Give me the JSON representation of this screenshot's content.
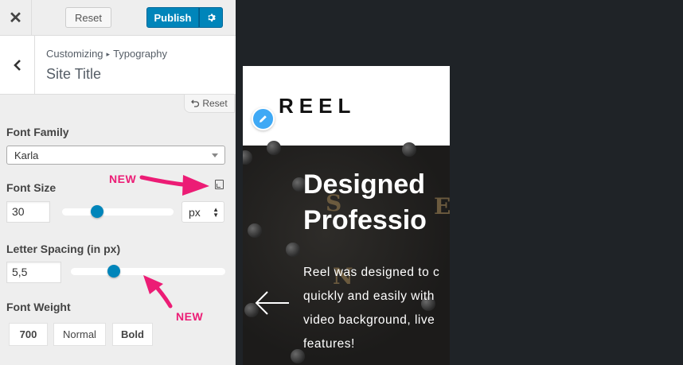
{
  "topbar": {
    "close_icon": "close-icon",
    "reset_label": "Reset",
    "publish_label": "Publish",
    "publish_settings_icon": "gear-icon",
    "publish_color": "#0085ba"
  },
  "section": {
    "breadcrumb_parent": "Customizing",
    "breadcrumb_separator": "▸",
    "breadcrumb_current": "Typography",
    "title": "Site Title",
    "reset_label": "Reset"
  },
  "controls": {
    "font_family": {
      "label": "Font Family",
      "value": "Karla"
    },
    "font_size": {
      "label": "Font Size",
      "value": "30",
      "unit": "px",
      "responsive_icon": "responsive-icon",
      "slider_fraction": 0.31
    },
    "letter_spacing": {
      "label": "Letter Spacing (in px)",
      "value": "5,5",
      "slider_fraction": 0.27
    },
    "font_weight": {
      "label": "Font Weight",
      "options": [
        "700",
        "Normal",
        "Bold"
      ]
    }
  },
  "annotations": {
    "new_1": "NEW",
    "new_2": "NEW",
    "accent_color": "#ec1c75"
  },
  "preview": {
    "logo": "REEL",
    "edit_icon": "pencil-icon",
    "hero_title_line1": "Designed",
    "hero_title_line2": "Professio",
    "hero_text_line1": "Reel was designed to c",
    "hero_text_line2": "quickly and easily with",
    "hero_text_line3": "video background, live",
    "hero_text_line4": "features!",
    "prev_arrow_icon": "arrow-left-icon"
  }
}
